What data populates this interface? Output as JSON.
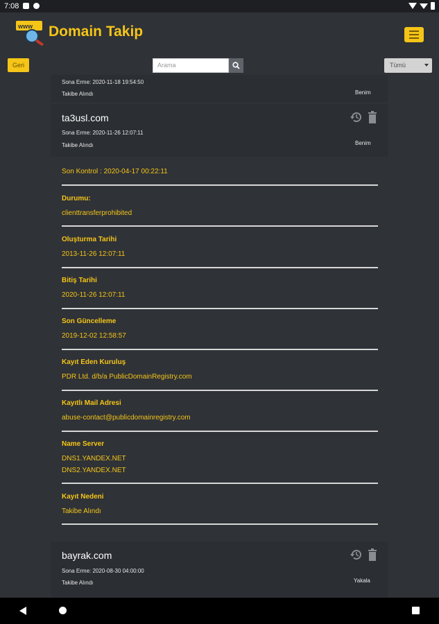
{
  "status_bar": {
    "time": "7:08"
  },
  "header": {
    "title": "Domain Takip"
  },
  "toolbar": {
    "back_label": "Geri",
    "search_placeholder": "Arama",
    "filter_selected": "Tümü"
  },
  "entries": [
    {
      "domain": "",
      "expiry": "Sona Erme: 2020-11-18 19:54:50",
      "status": "Takibe Alındı",
      "owner": "Benim"
    },
    {
      "domain": "ta3usl.com",
      "expiry": "Sona Erme: 2020-11-26 12:07:11",
      "status": "Takibe Alındı",
      "owner": "Benim"
    },
    {
      "domain": "bayrak.com",
      "expiry": "Sona Erme: 2020-08-30 04:00:00",
      "status": "Takibe Alındı",
      "owner": "Yakala"
    }
  ],
  "details": {
    "last_check": "Son Kontrol : 2020-04-17 00:22:11",
    "status_label": "Durumu:",
    "status_value": "clienttransferprohibited",
    "created_label": "Oluşturma Tarihi",
    "created_value": "2013-11-26 12:07:11",
    "expiry_label": "Bitiş Tarihi",
    "expiry_value": "2020-11-26 12:07:11",
    "updated_label": "Son Güncelleme",
    "updated_value": "2019-12-02 12:58:57",
    "registrar_label": "Kayıt Eden Kuruluş",
    "registrar_value": "PDR Ltd. d/b/a PublicDomainRegistry.com",
    "mail_label": "Kayıtlı Mail Adresi",
    "mail_value": "abuse-contact@publicdomainregistry.com",
    "ns_label": "Name Server",
    "ns_values": [
      "DNS1.YANDEX.NET",
      "DNS2.YANDEX.NET"
    ],
    "reason_label": "Kayıt Nedeni",
    "reason_value": "Takibe Alındı"
  },
  "colors": {
    "accent": "#f5c518",
    "background": "#2f3237",
    "card": "#2b2e33"
  },
  "icons": [
    "history-icon",
    "trash-icon",
    "search-icon",
    "menu-icon",
    "www-logo-icon"
  ]
}
